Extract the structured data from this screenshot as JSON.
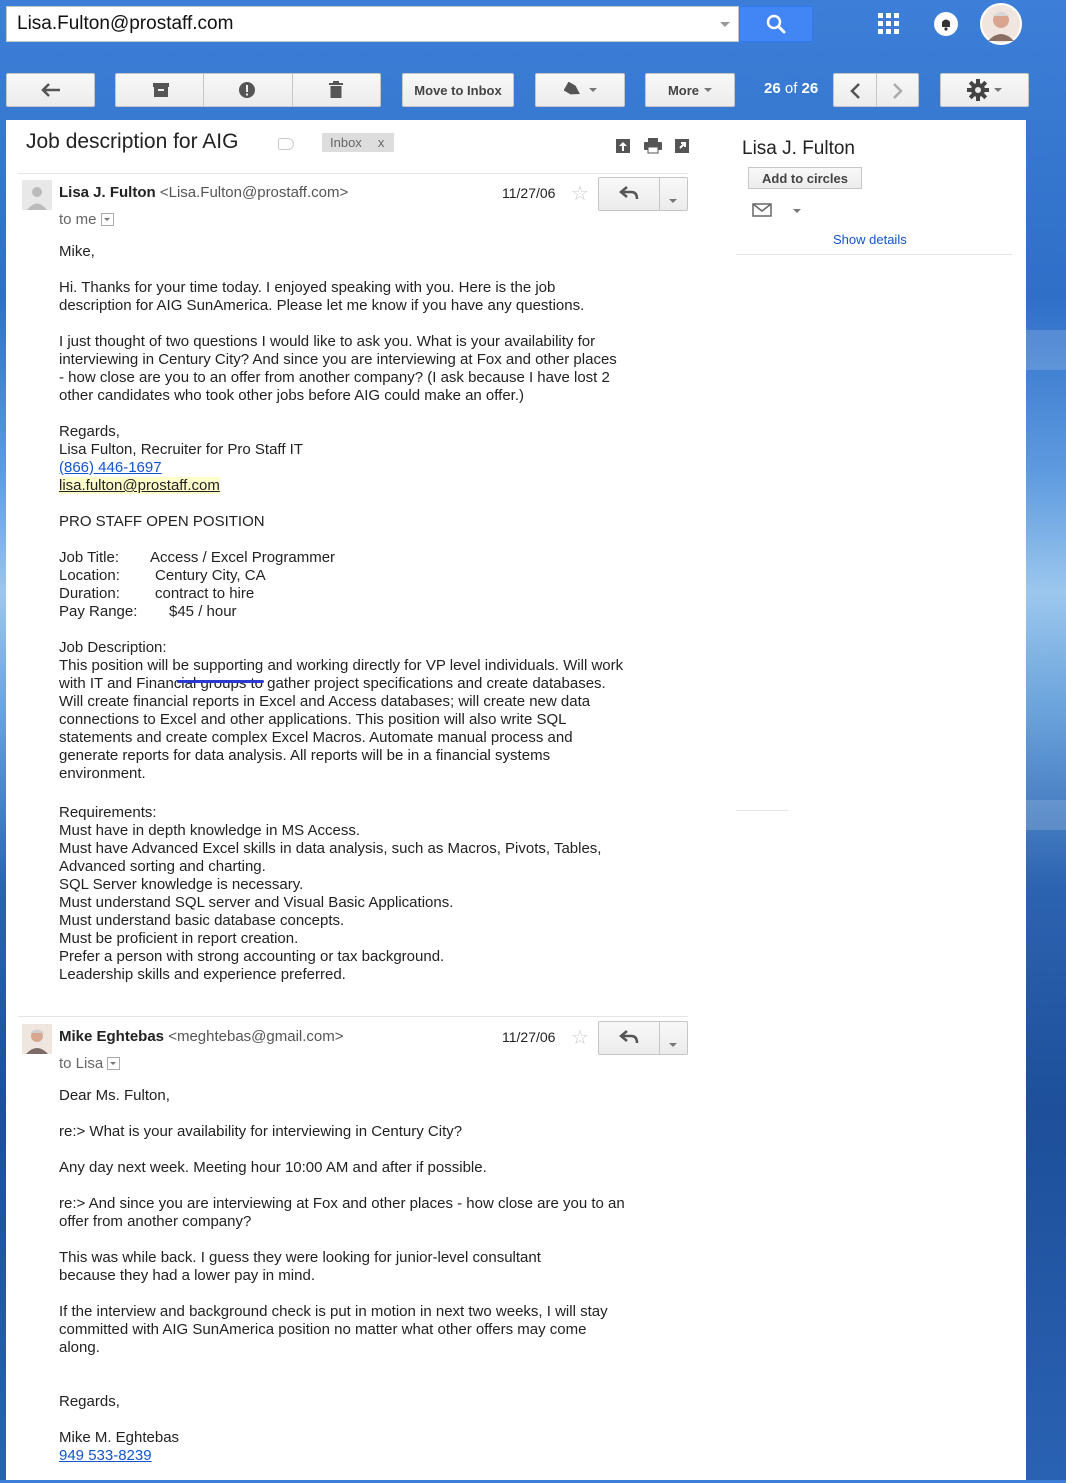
{
  "search": {
    "value": "Lisa.Fulton@prostaff.com"
  },
  "toolbar": {
    "move_label": "Move to Inbox",
    "more_label": "More",
    "count_range": "26",
    "count_of": "of",
    "count_total": "26"
  },
  "thread": {
    "subject": "Job description for AIG",
    "label": "Inbox",
    "label_close": "x"
  },
  "message1": {
    "sender_name": "Lisa J. Fulton",
    "sender_email": "<Lisa.Fulton@prostaff.com>",
    "date": "11/27/06",
    "to": "to me",
    "greeting": "Mike,",
    "p1_l1": "Hi.  Thanks for your time today.  I enjoyed speaking with you.  Here is the job",
    "p1_l2": "description for AIG SunAmerica.  Please let me know if you have any questions.",
    "p2_l1": "I just thought of two questions I would like to ask you.  What is your availability for",
    "p2_l2": "interviewing in Century City?  And since you are interviewing at Fox and other places",
    "p2_l3": "- how close are you to an offer from another company?  (I ask because I have lost 2",
    "p2_l4": "other candidates who took other jobs before AIG could make an offer.)",
    "regards": "Regards,",
    "sig_name": "Lisa Fulton, Recruiter for Pro Staff IT",
    "sig_phone": "(866) 446-1697",
    "sig_email": "lisa.fulton@prostaff.com",
    "open_position": "PRO STAFF OPEN POSITION",
    "job_title_label": "Job Title:",
    "job_title": "Access / Excel Programmer",
    "location_label": "Location:",
    "location": "Century City, CA",
    "duration_label": "Duration:",
    "duration": "contract to hire",
    "pay_label": "Pay Range:",
    "pay": "$45 / hour",
    "jd_label": "Job Description:",
    "jd": [
      "This position will be supporting and working directly for VP level individuals. Will work",
      "with IT and Financial groups to gather project specifications and create databases.",
      "Will create financial reports in Excel and Access databases; will create new data",
      "connections to Excel and other applications. This position will also write SQL",
      "statements and create complex Excel Macros.  Automate manual process and",
      "generate reports for data analysis.  All reports will be in a financial systems",
      "environment."
    ],
    "req_label": "Requirements:",
    "req": [
      "Must have in depth knowledge in MS Access.",
      "Must have Advanced Excel skills in data analysis, such as Macros, Pivots, Tables,",
      "Advanced sorting and charting.",
      "SQL Server knowledge is necessary.",
      "Must understand SQL server and Visual Basic Applications.",
      "Must understand basic database concepts.",
      "Must be proficient in report creation.",
      "Prefer a person with strong accounting or tax background.",
      "Leadership skills and experience preferred."
    ]
  },
  "message2": {
    "sender_name": "Mike Eghtebas",
    "sender_email": "<meghtebas@gmail.com>",
    "date": "11/27/06",
    "to": "to Lisa",
    "greeting": "Dear Ms. Fulton,",
    "q1": "re:> What is your availability for interviewing in Century City?",
    "a1": "Any day next week.  Meeting hour 10:00 AM and after if possible.",
    "q2_l1": "re:> And since you are interviewing at Fox and other places - how close are you to an",
    "q2_l2": "offer from another company?",
    "a2_l1": "This was while back.  I guess they were looking for junior-level consultant",
    "a2_l2": "because they had a lower pay in mind.",
    "a3_l1": "If the interview and background check is put in motion in next two weeks, I will stay",
    "a3_l2": "committed with AIG SunAmerica position no matter what other offers may come",
    "a3_l3": "along.",
    "regards": "Regards,",
    "sig_name": "Mike M. Eghtebas",
    "sig_phone": "949 533-8239"
  },
  "sidebar": {
    "contact_name": "Lisa J. Fulton",
    "add_circles": "Add to circles",
    "show_details": "Show details"
  },
  "colors": {
    "accent": "#4285f4",
    "link": "#1155cc",
    "mark": "#2a3ad0"
  }
}
